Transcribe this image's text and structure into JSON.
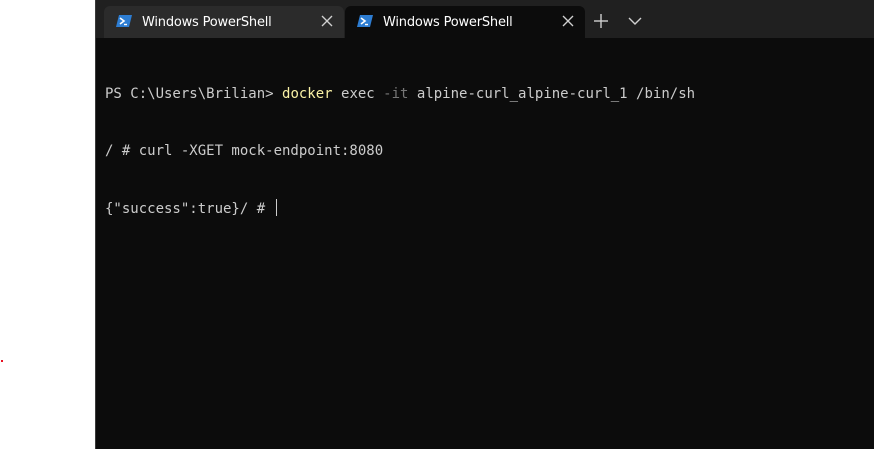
{
  "tabs": [
    {
      "title": "Windows PowerShell",
      "icon": "powershell-icon",
      "active": false
    },
    {
      "title": "Windows PowerShell",
      "icon": "powershell-icon",
      "active": true
    }
  ],
  "tabbar_controls": {
    "new_tab_icon": "plus-icon",
    "dropdown_icon": "chevron-down-icon"
  },
  "terminal": {
    "line1": {
      "prompt": "PS C:\\Users\\Brilian> ",
      "command": "docker",
      "args1": " exec ",
      "param": "-it",
      "args2": " alpine-curl_alpine-curl_1 /bin/sh"
    },
    "line2": "/ # curl -XGET mock-endpoint:8080",
    "line3": "{\"success\":true}/ # "
  },
  "colors": {
    "terminal_bg": "#0c0c0c",
    "tabbar_bg": "#202020",
    "text": "#cccccc",
    "command": "#f9f1a5",
    "parameter": "#767676",
    "powershell_icon": "#2d7dd2"
  }
}
